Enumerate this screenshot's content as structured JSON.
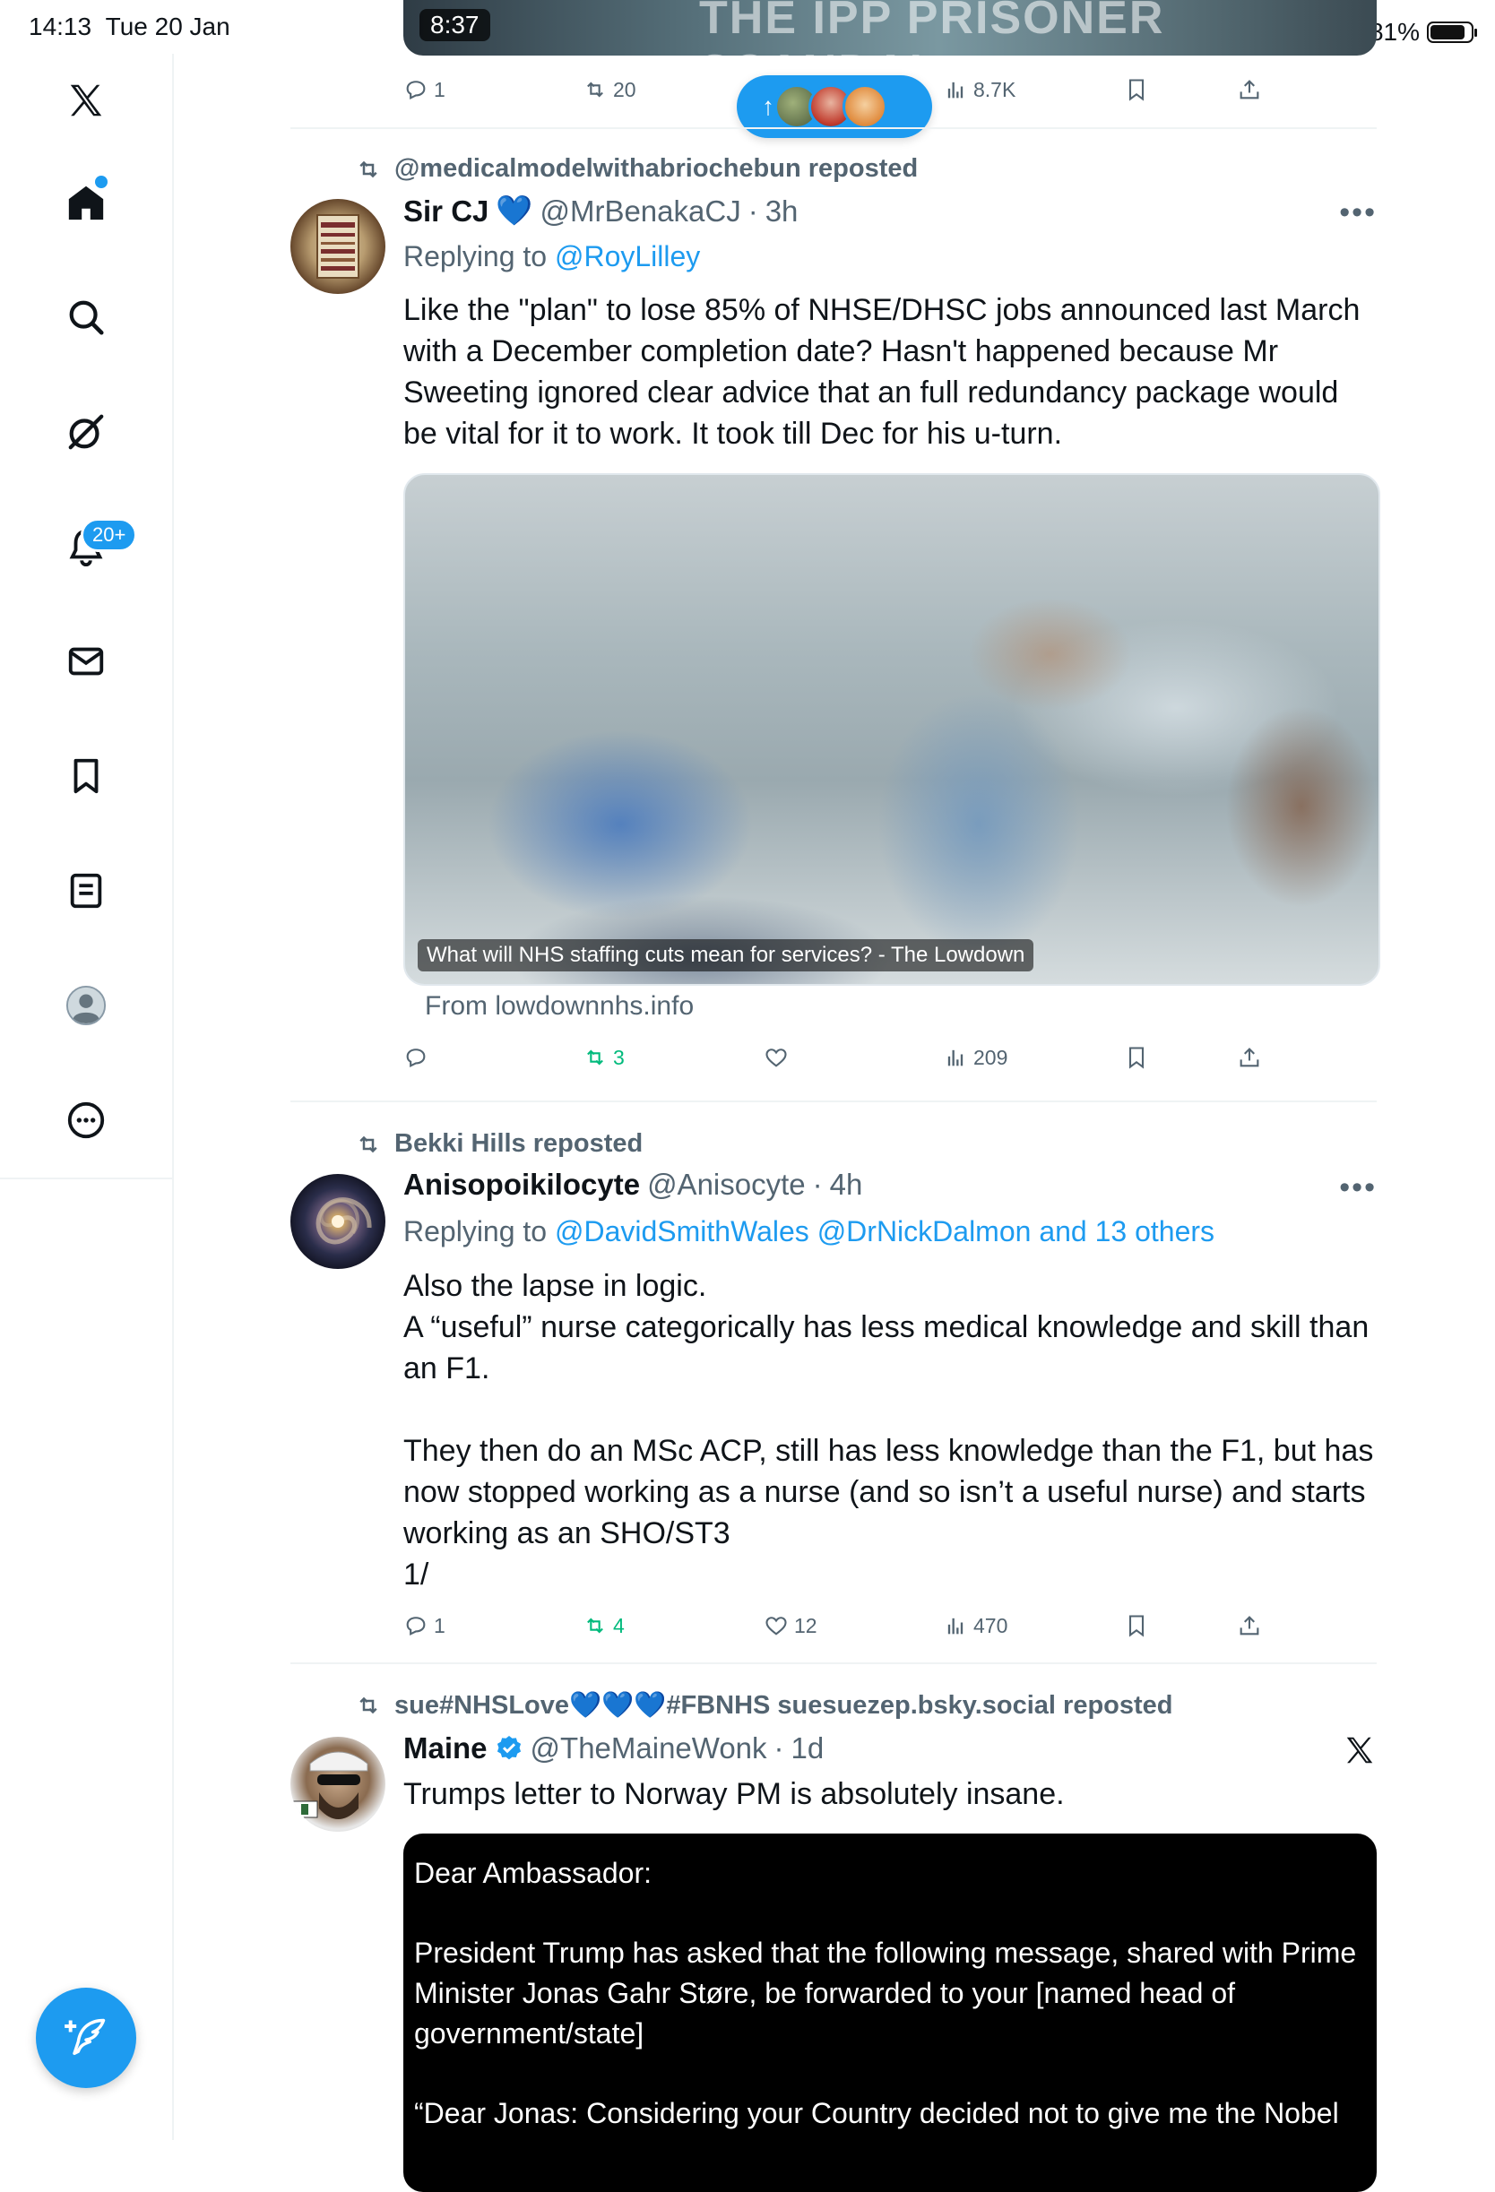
{
  "status_bar": {
    "time": "14:13",
    "date": "Tue 20 Jan",
    "battery": "81%"
  },
  "nav": {
    "notifications_badge": "20+"
  },
  "top_post": {
    "video_time": "8:37",
    "video_title": "THE IPP PRISONER SCANDAL",
    "replies": "1",
    "reposts": "20",
    "views": "8.7K"
  },
  "posts": [
    {
      "reposted_by": "@medicalmodelwithabriochebun reposted",
      "name": "Sir CJ",
      "badge": "💙",
      "handle": "@MrBenakaCJ",
      "time": "3h",
      "replying_prefix": "Replying to",
      "replying_to": "@RoyLilley",
      "text": "Like the \"plan\" to lose 85% of NHSE/DHSC jobs announced last March with a December completion date? Hasn't happened because Mr Sweeting ignored clear advice that an full redundancy package would be vital for it to work. It took till Dec for his u-turn.",
      "link_caption": "What will NHS staffing cuts mean for services? - The Lowdown",
      "link_from": "From lowdownnhs.info",
      "replies": "",
      "reposts": "3",
      "likes": "",
      "views": "209"
    },
    {
      "reposted_by": "Bekki Hills reposted",
      "name": "Anisopoikilocyte",
      "handle": "@Anisocyte",
      "time": "4h",
      "replying_prefix": "Replying to",
      "replying_to": "@DavidSmithWales @DrNickDalmon and 13 others",
      "text_lines": [
        "Also the lapse in logic.",
        "A “useful” nurse categorically has less medical knowledge and skill than an F1.",
        "",
        "They then do an MSc ACP, still has less knowledge than the F1, but has now stopped working as a nurse (and so isn’t a useful nurse) and starts working as an SHO/ST3",
        "1/"
      ],
      "replies": "1",
      "reposts": "4",
      "likes": "12",
      "views": "470"
    },
    {
      "reposted_by": "sue#NHSLove💙💙💙#FBNHS suesuezep.bsky.social reposted",
      "name": "Maine",
      "handle": "@TheMaineWonk",
      "time": "1d",
      "text": "Trumps letter to Norway PM is absolutely insane.",
      "quoted_lines": [
        "Dear Ambassador:",
        "",
        "President Trump has asked that the following message, shared with Prime Minister Jonas Gahr Støre, be forwarded to your [named head of government/state]",
        "",
        "“Dear Jonas: Considering your Country decided not to give me the Nobel"
      ]
    }
  ],
  "colors": {
    "accent": "#1d9bf0",
    "muted": "#536471",
    "repost_green": "#00ba7c",
    "text": "#0f1419"
  }
}
